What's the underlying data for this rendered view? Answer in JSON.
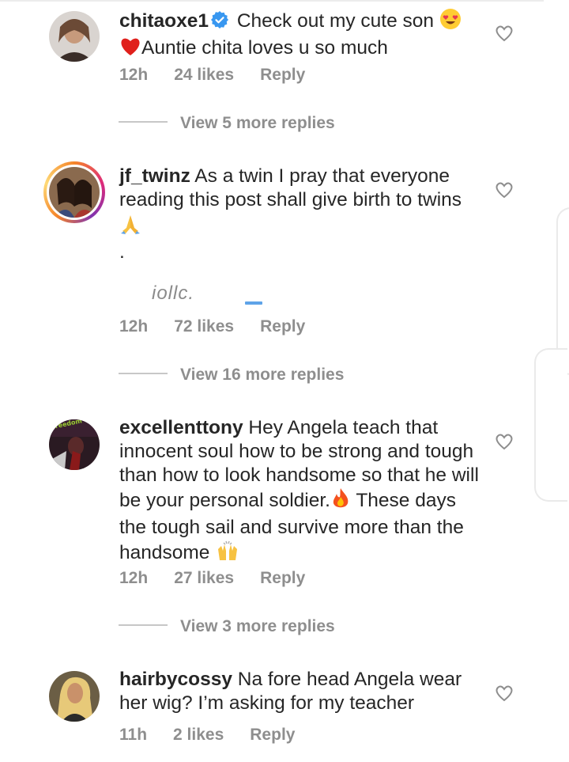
{
  "comments": [
    {
      "username": "chitaoxe1",
      "verified": true,
      "text_part1": " Check out my cute son ",
      "emoji1": "heart-eyes-emoji",
      "emoji2": "red-heart-emoji",
      "text_part2": "Auntie chita loves u so much",
      "time": "12h",
      "likes": "24 likes",
      "reply": "Reply",
      "more_replies": "View 5 more replies"
    },
    {
      "username": "jf_twinz",
      "text": " As a twin I pray that everyone reading this post shall give birth to twins ",
      "emoji": "folded-hands-emoji",
      "dot": ".",
      "faded_text": "iollc.",
      "time": "12h",
      "likes": "72 likes",
      "reply": "Reply",
      "more_replies": "View 16 more replies"
    },
    {
      "username": "excellenttony",
      "text": " Hey Angela teach that innocent soul how to be strong and tough than how to look handsome so that he will be your personal soldier.",
      "emoji1": "fire-emoji",
      "text2": " These days the tough sail and survive more than the handsome ",
      "emoji2": "raising-hands-emoji",
      "avatar_text": "freedom",
      "time": "12h",
      "likes": "27 likes",
      "reply": "Reply",
      "more_replies": "View 3 more replies"
    },
    {
      "username": "hairbycossy",
      "text": " Na fore head Angela wear her wig? I’m asking for my  teacher",
      "time": "11h",
      "likes": "2 likes",
      "reply": "Reply"
    }
  ],
  "colors": {
    "text": "#262626",
    "meta": "#8e8e8e",
    "verified": "#3897f0"
  }
}
